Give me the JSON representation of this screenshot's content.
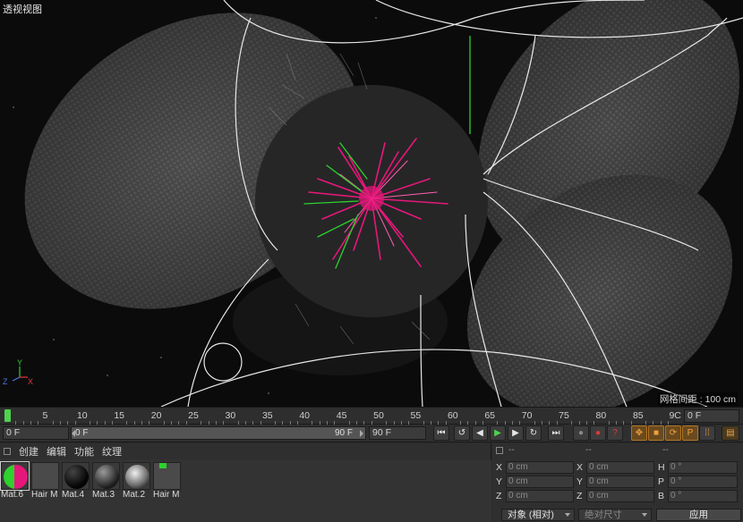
{
  "viewport": {
    "title": "透视视图",
    "grid_spacing": "网格间距 : 100 cm",
    "axes": {
      "y": "Y",
      "z": "Z",
      "x": "X"
    }
  },
  "timeline": {
    "ticks": [
      "0",
      "5",
      "10",
      "15",
      "20",
      "25",
      "30",
      "35",
      "40",
      "45",
      "50",
      "55",
      "60",
      "65",
      "70",
      "75",
      "80",
      "85",
      "90"
    ],
    "last_tick_display": "9C",
    "current_frame": "0 F",
    "start_frame": "0 F",
    "range_start": "0 F",
    "range_end": "90 F",
    "end_frame": "90 F"
  },
  "transport": {
    "buttons": [
      {
        "name": "go-to-start",
        "icon": "⏮"
      },
      {
        "name": "prev-key",
        "icon": "↺"
      },
      {
        "name": "prev-frame",
        "icon": "◀"
      },
      {
        "name": "play",
        "icon": "▶"
      },
      {
        "name": "next-frame",
        "icon": "▶"
      },
      {
        "name": "next-key",
        "icon": "↻"
      },
      {
        "name": "go-to-end",
        "icon": "⏭"
      }
    ],
    "record_icons": [
      "autokey",
      "record",
      "help"
    ],
    "key_icons": [
      "move",
      "scale",
      "rotate",
      "param",
      "pla"
    ]
  },
  "materials": {
    "menu": [
      "创建",
      "编辑",
      "功能",
      "纹理"
    ],
    "items": [
      {
        "name": "Mat.6",
        "kind": "pink-green"
      },
      {
        "name": "Hair M",
        "kind": "hair"
      },
      {
        "name": "Mat.4",
        "kind": "black"
      },
      {
        "name": "Mat.3",
        "kind": "dark-metal"
      },
      {
        "name": "Mat.2",
        "kind": "chrome"
      },
      {
        "name": "Hair M",
        "kind": "hair-green"
      }
    ]
  },
  "coordinates": {
    "headers": [
      "--",
      "--",
      "--"
    ],
    "rows": [
      {
        "l1": "X",
        "v1": "0 cm",
        "l2": "X",
        "v2": "0 cm",
        "l3": "H",
        "v3": "0 °"
      },
      {
        "l1": "Y",
        "v1": "0 cm",
        "l2": "Y",
        "v2": "0 cm",
        "l3": "P",
        "v3": "0 °"
      },
      {
        "l1": "Z",
        "v1": "0 cm",
        "l2": "Z",
        "v2": "0 cm",
        "l3": "B",
        "v3": "0 °"
      }
    ],
    "mode_dropdown": "对象 (相对)",
    "size_dropdown": "绝对尺寸",
    "apply": "应用"
  },
  "colors": {
    "accent_green": "#4fd24f",
    "pink": "#e6177a",
    "green": "#2ed12e"
  }
}
